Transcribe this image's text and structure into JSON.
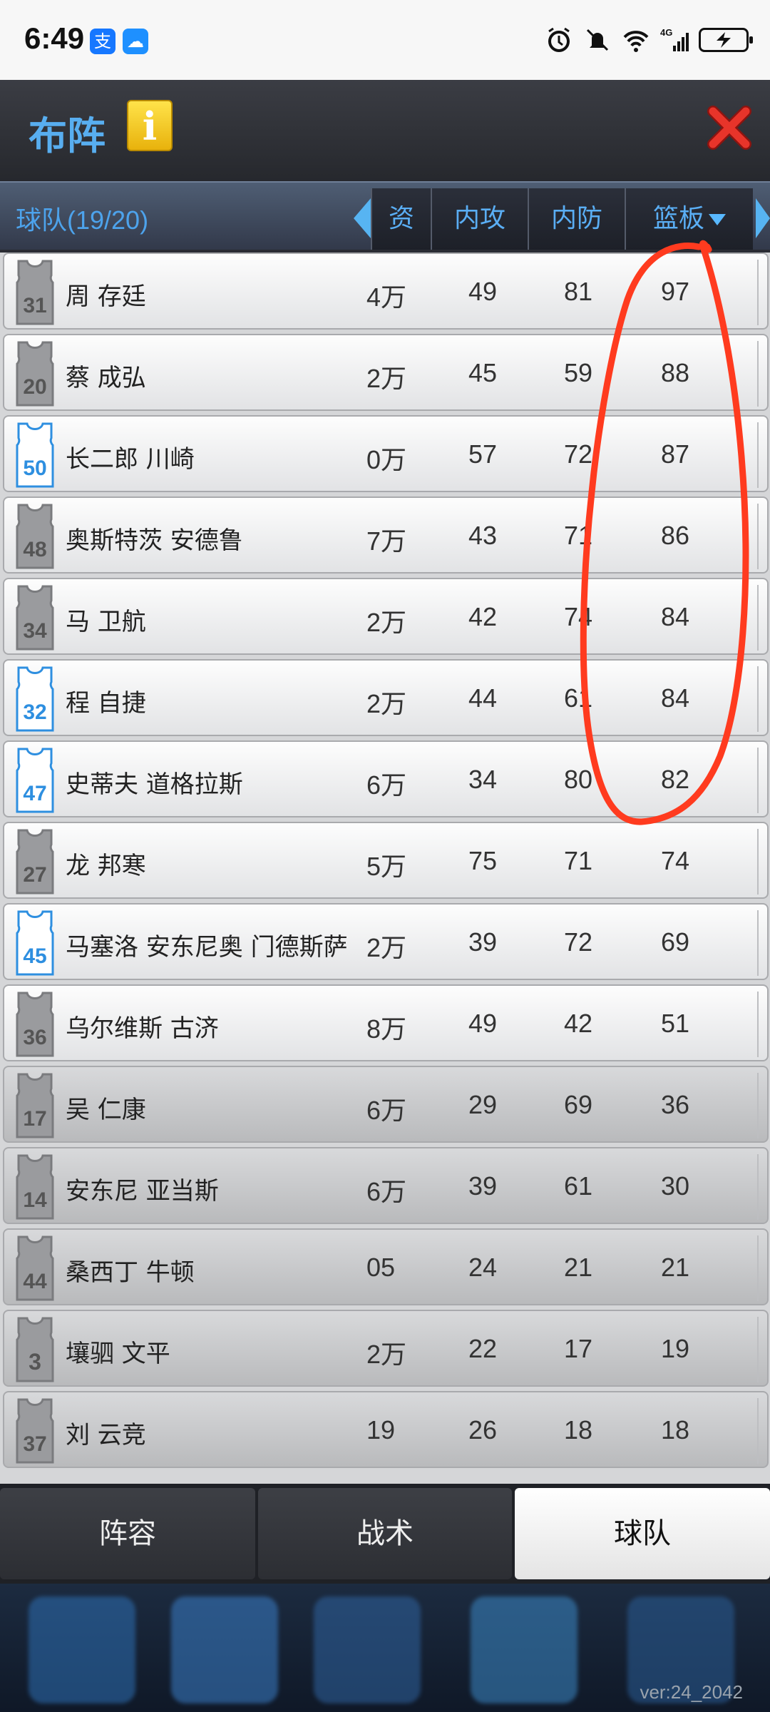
{
  "status_bar": {
    "time": "6:49",
    "app_icons": [
      "alipay-icon",
      "cloud-icon"
    ],
    "right_icons": [
      "alarm-icon",
      "mute-icon",
      "wifi-icon",
      "signal-icon",
      "battery-icon"
    ],
    "network": "4G"
  },
  "header": {
    "title": "布阵",
    "info_label": "i"
  },
  "table": {
    "team_label": "球队(19/20)",
    "columns": {
      "salary": "资",
      "inside_attack": "内攻",
      "inside_defense": "内防",
      "rebound": "篮板"
    },
    "rows": [
      {
        "number": "31",
        "name": "周 存廷",
        "salary": "4万",
        "inside_attack": "49",
        "inside_defense": "81",
        "rebound": "97"
      },
      {
        "number": "20",
        "name": "蔡 成弘",
        "salary": "2万",
        "inside_attack": "45",
        "inside_defense": "59",
        "rebound": "88"
      },
      {
        "number": "50",
        "name": "长二郎 川崎",
        "salary": "0万",
        "inside_attack": "57",
        "inside_defense": "72",
        "rebound": "87"
      },
      {
        "number": "48",
        "name": "奥斯特茨 安德鲁",
        "salary": "7万",
        "inside_attack": "43",
        "inside_defense": "71",
        "rebound": "86"
      },
      {
        "number": "34",
        "name": "马 卫航",
        "salary": "2万",
        "inside_attack": "42",
        "inside_defense": "74",
        "rebound": "84"
      },
      {
        "number": "32",
        "name": "程 自捷",
        "salary": "2万",
        "inside_attack": "44",
        "inside_defense": "61",
        "rebound": "84"
      },
      {
        "number": "47",
        "name": "史蒂夫 道格拉斯",
        "salary": "6万",
        "inside_attack": "34",
        "inside_defense": "80",
        "rebound": "82"
      },
      {
        "number": "27",
        "name": "龙 邦寒",
        "salary": "5万",
        "inside_attack": "75",
        "inside_defense": "71",
        "rebound": "74"
      },
      {
        "number": "45",
        "name": "马塞洛 安东尼奥 门德斯萨",
        "salary": "2万",
        "inside_attack": "39",
        "inside_defense": "72",
        "rebound": "69"
      },
      {
        "number": "36",
        "name": "乌尔维斯 古济",
        "salary": "8万",
        "inside_attack": "49",
        "inside_defense": "42",
        "rebound": "51"
      },
      {
        "number": "17",
        "name": "吴 仁康",
        "salary": "6万",
        "inside_attack": "29",
        "inside_defense": "69",
        "rebound": "36"
      },
      {
        "number": "14",
        "name": "安东尼 亚当斯",
        "salary": "6万",
        "inside_attack": "39",
        "inside_defense": "61",
        "rebound": "30"
      },
      {
        "number": "44",
        "name": "桑西丁 牛顿",
        "salary": "05",
        "inside_attack": "24",
        "inside_defense": "21",
        "rebound": "21"
      },
      {
        "number": "3",
        "name": "壤驷 文平",
        "salary": "2万",
        "inside_attack": "22",
        "inside_defense": "17",
        "rebound": "19"
      },
      {
        "number": "37",
        "name": "刘 云竞",
        "salary": "19",
        "inside_attack": "26",
        "inside_defense": "18",
        "rebound": "18"
      }
    ],
    "jersey_colors": {
      "blue": [
        "50",
        "32",
        "47",
        "45"
      ]
    },
    "dark_rows_from_index": 10
  },
  "tabs": {
    "lineup": "阵容",
    "tactics": "战术",
    "team": "球队",
    "active": "team"
  },
  "bottom_nav": {
    "version": "ver:24_2042"
  },
  "colors": {
    "accent_blue": "#58aef0",
    "annotation_red": "#ff3b1f",
    "close_red": "#d8261e",
    "info_yellow": "#f5c518"
  }
}
